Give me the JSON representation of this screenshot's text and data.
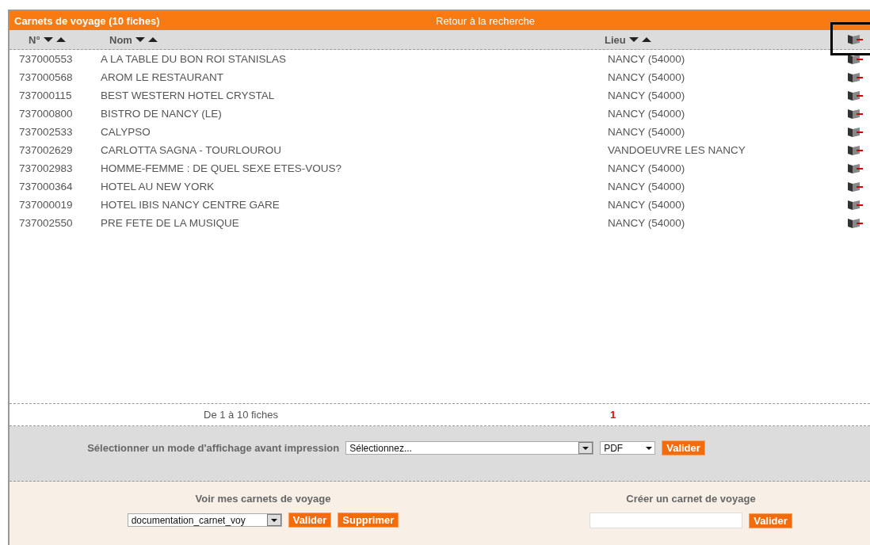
{
  "title_bar": {
    "title": "Carnets de voyage (10  fiches)",
    "back_link": "Retour à la recherche"
  },
  "columns": [
    {
      "label": "N°"
    },
    {
      "label": "Nom"
    },
    {
      "label": "Lieu"
    }
  ],
  "header_icon": {
    "highlighted": true
  },
  "rows": [
    {
      "number": "737000553",
      "name": "A LA TABLE DU BON ROI STANISLAS",
      "place": "NANCY  (54000)"
    },
    {
      "number": "737000568",
      "name": "AROM LE RESTAURANT",
      "place": "NANCY  (54000)"
    },
    {
      "number": "737000115",
      "name": "BEST WESTERN HOTEL CRYSTAL",
      "place": "NANCY  (54000)"
    },
    {
      "number": "737000800",
      "name": "BISTRO DE NANCY (LE)",
      "place": "NANCY  (54000)"
    },
    {
      "number": "737002533",
      "name": "CALYPSO",
      "place": "NANCY  (54000)"
    },
    {
      "number": "737002629",
      "name": "CARLOTTA SAGNA - TOURLOUROU",
      "place": "VANDOEUVRE LES NANCY"
    },
    {
      "number": "737002983",
      "name": "HOMME-FEMME : DE QUEL SEXE ETES-VOUS?",
      "place": "NANCY  (54000)"
    },
    {
      "number": "737000364",
      "name": "HOTEL AU NEW YORK",
      "place": "NANCY  (54000)"
    },
    {
      "number": "737000019",
      "name": "HOTEL IBIS NANCY CENTRE GARE",
      "place": "NANCY  (54000)"
    },
    {
      "number": "737002550",
      "name": "PRE FETE DE LA MUSIQUE",
      "place": "NANCY  (54000)"
    }
  ],
  "pagination": {
    "range": "De 1 à 10 fiches",
    "pages": [
      {
        "label": "1",
        "selected": true
      }
    ]
  },
  "print": {
    "label": "Sélectionner un mode d'affichage avant impression",
    "mode": "Sélectionnez...",
    "format": "PDF",
    "button": "Valider"
  },
  "my_books": {
    "heading": "Voir mes carnets de voyage",
    "selection": "documentation_carnet_voy",
    "buttons": [
      "Valider",
      "Supprimer"
    ]
  },
  "create_book": {
    "heading": "Créer un carnet de voyage",
    "button": "Valider"
  }
}
